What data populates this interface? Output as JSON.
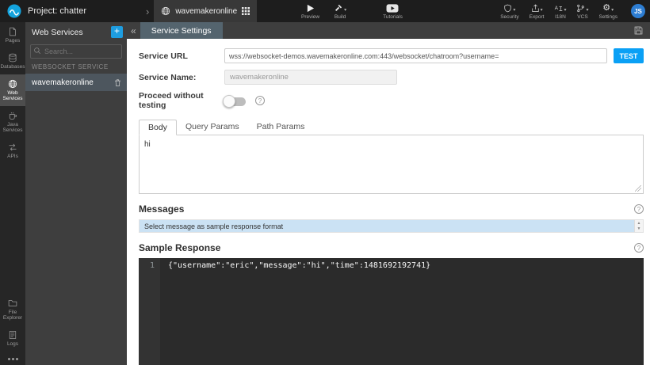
{
  "topbar": {
    "project": "Project: chatter",
    "app_name": "wavemakeronline",
    "preview_label": "Preview",
    "build_label": "Build",
    "tutorials_label": "Tutorials",
    "security_label": "Security",
    "export_label": "Export",
    "i18n_label": "I18N",
    "vcs_label": "VCS",
    "settings_label": "Settings",
    "avatar_initials": "JS"
  },
  "left_rail": {
    "items": [
      {
        "label": "Pages"
      },
      {
        "label": "Databases"
      },
      {
        "label": "Web Services"
      },
      {
        "label": "Java Services"
      },
      {
        "label": "APIs"
      }
    ],
    "bottom": [
      {
        "label": "File Explorer"
      },
      {
        "label": "Logs"
      }
    ]
  },
  "services_panel": {
    "title": "Web Services",
    "collapse_icon": "«",
    "search_placeholder": "Search...",
    "section_title": "WEBSOCKET SERVICE",
    "service_name": "wavemakeronline"
  },
  "service_settings": {
    "tab_title": "Service Settings",
    "fields": {
      "service_url_label": "Service URL",
      "service_url_value": "wss://websocket-demos.wavemakeronline.com:443/websocket/chatroom?username=",
      "test_button": "TEST",
      "service_name_label": "Service Name:",
      "service_name_value": "wavemakeronline",
      "proceed_label": "Proceed without testing"
    },
    "request_tabs": [
      {
        "label": "Body"
      },
      {
        "label": "Query Params"
      },
      {
        "label": "Path Params"
      }
    ],
    "body_text": "hi",
    "messages": {
      "title": "Messages",
      "selected_option": "Select message as sample response format"
    },
    "sample_response": {
      "title": "Sample Response",
      "line_number": "1",
      "code": "{\"username\":\"eric\",\"message\":\"hi\",\"time\":1481692192741}"
    }
  },
  "colors": {
    "accent_blue": "#0aa0f5",
    "selection_blue": "#cbe2f4",
    "editor_bg": "#2b2b2b"
  }
}
